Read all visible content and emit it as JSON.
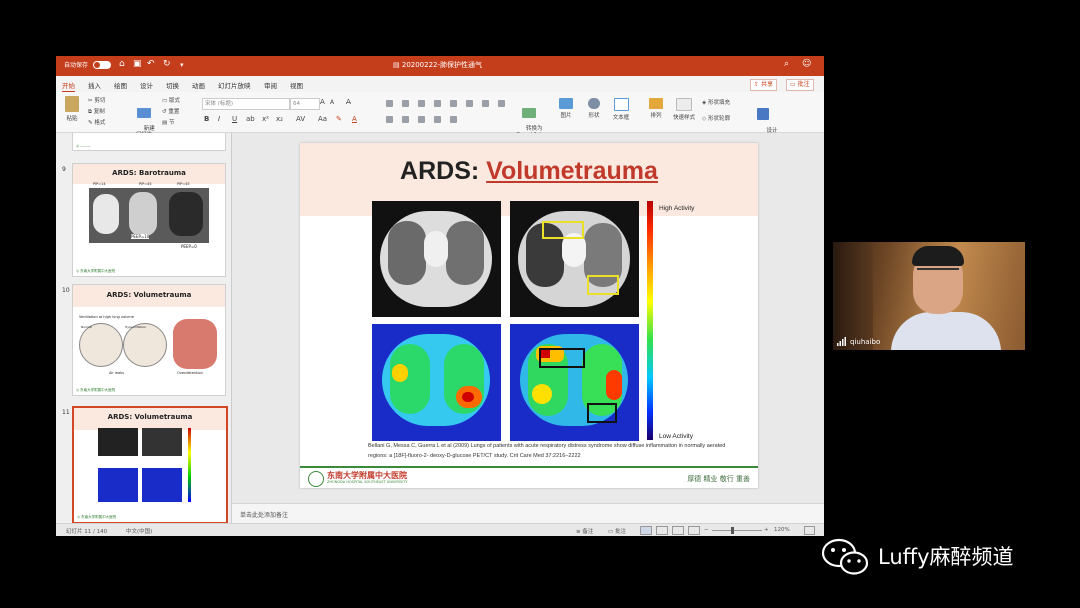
{
  "app": {
    "autosave_label": "自动保存",
    "autosave_state": "关闭",
    "file_title": "20200222-肺保护性通气"
  },
  "ribbon_tabs": [
    "开始",
    "插入",
    "绘图",
    "设计",
    "切换",
    "动画",
    "幻灯片放映",
    "审阅",
    "视图"
  ],
  "top_buttons": {
    "share": "共享",
    "comments": "批注"
  },
  "ribbon": {
    "paste": "粘贴",
    "cut": "剪切",
    "copy": "复制",
    "format": "格式",
    "new_slide": "新建\n幻灯片",
    "layout": "版式",
    "reset": "重置",
    "section": "节",
    "font_name": "宋体 (标题)",
    "font_size": "64",
    "convert_smartart": "转换为\nSmartArt",
    "picture": "图片",
    "shape": "形状",
    "textbox": "文本框",
    "arrange": "排列",
    "quick_styles": "快速样式",
    "shape_fill": "形状填充",
    "shape_outline": "形状轮廓",
    "design_ideas": "设计\n灵感"
  },
  "thumbnails": [
    {
      "num": "9",
      "title": "ARDS: Barotrauma"
    },
    {
      "num": "10",
      "title": "ARDS: Volumetrauma"
    },
    {
      "num": "11",
      "title": "ARDS: Volumetrauma"
    }
  ],
  "thumb_details": {
    "pip": [
      "PIP=14",
      "PIP=45",
      "PIP=45"
    ],
    "peep10": "PEEP=10",
    "peep0": "PEEP=0",
    "ventilation_title": "Ventilation at high lung volume",
    "normal": "Normal",
    "hyperinflation": "Hyperinflation",
    "air_leaks": "Air leaks",
    "overdistention": "Overdistention"
  },
  "slide": {
    "title_prefix": "ARDS: ",
    "title_underlined": "Volumetrauma",
    "high_label": "High Activity",
    "low_label": "Low Activity",
    "citation": "Bellani G, Messa C, Guerra L et al (2009) Lungs of patients with acute respiratory distress syndrome show diffuse inflammation in normally aerated regions: a [18F]-fluoro-2- deoxy-D-glucose PET/CT study. Crit Care Med 37:2216–2222",
    "hospital_name": "东南大学附属中大医院",
    "hospital_en": "ZHONGDA HOSPITAL SOUTHEAST UNIVERSITY",
    "motto": "厚德  精业  敬行  重善"
  },
  "notes_placeholder": "单击此处添加备注",
  "status": {
    "slide_pos": "幻灯片 11 / 140",
    "language": "中文(中国)",
    "notes_btn": "备注",
    "comments_btn": "批注",
    "zoom": "120%"
  },
  "webcam": {
    "participant": "qiuhaibo"
  },
  "watermark": {
    "text": "Luffy麻醉频道"
  }
}
